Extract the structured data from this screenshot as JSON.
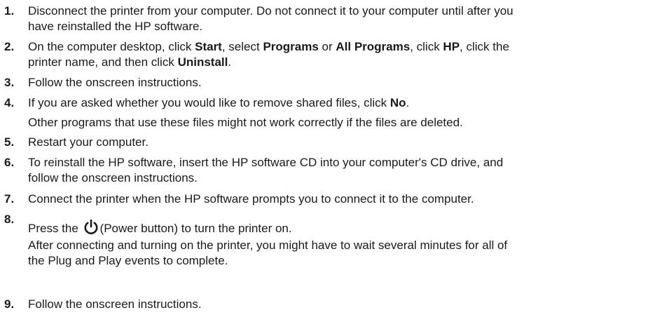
{
  "steps": [
    {
      "number": "1.",
      "lines": [
        "Disconnect the printer from your computer. Do not connect it to your computer until after you",
        "have reinstalled the HP software."
      ]
    },
    {
      "number": "2.",
      "line1": {
        "t1": "On the computer desktop, click ",
        "b1": "Start",
        "t2": ", select ",
        "b2": "Programs",
        "t3": " or ",
        "b3": "All Programs",
        "t4": ", click ",
        "b4": "HP",
        "t5": ", click the"
      },
      "line2": {
        "t1": "printer name, and then click ",
        "b1": "Uninstall",
        "t2": "."
      }
    },
    {
      "number": "3.",
      "text": "Follow the onscreen instructions."
    },
    {
      "number": "4.",
      "t1": "If you are asked whether you would like to remove shared files, click ",
      "b1": "No",
      "t2": ".",
      "note": "Other programs that use these files might not work correctly if the files are deleted."
    },
    {
      "number": "5.",
      "text": "Restart your computer."
    },
    {
      "number": "6.",
      "lines": [
        "To reinstall the HP software, insert the HP software CD into your computer's CD drive, and",
        "follow the onscreen instructions."
      ]
    },
    {
      "number": "7.",
      "text": "Connect the printer when the HP software prompts you to connect it to the computer."
    },
    {
      "number": "8.",
      "t1": "Press the ",
      "icon": "power-icon",
      "t2": "(Power button) to turn the printer on.",
      "note_lines": [
        "After connecting and turning on the printer, you might have to wait several minutes for all of",
        "the Plug and Play events to complete."
      ]
    },
    {
      "number": "9.",
      "text": "Follow the onscreen instructions."
    }
  ]
}
